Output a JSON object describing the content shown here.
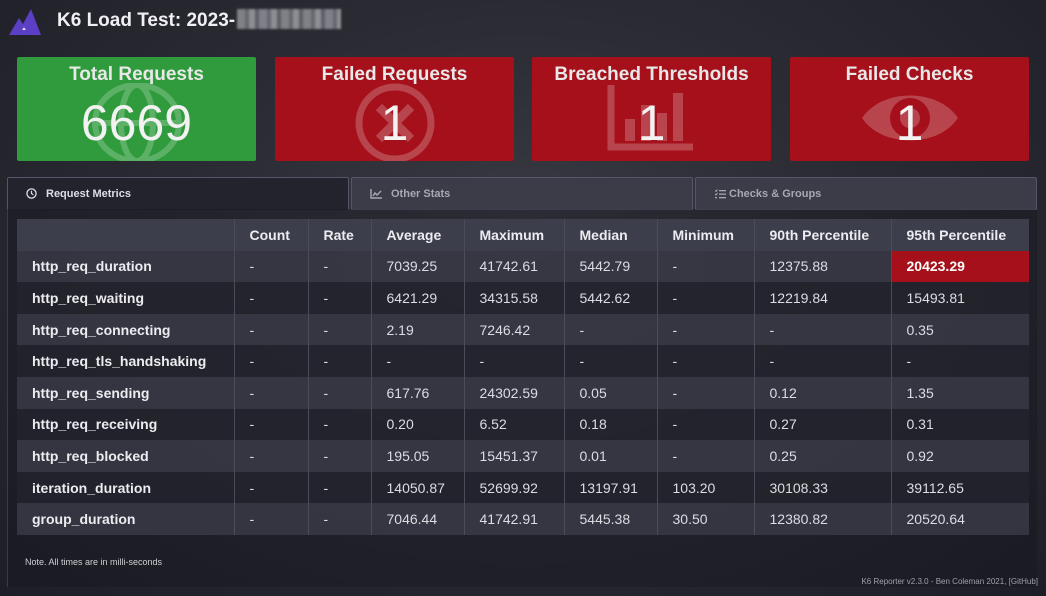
{
  "header": {
    "title": "K6 Load Test: 2023-",
    "logo_icon": "k6-logo-icon"
  },
  "cards": [
    {
      "title": "Total Requests",
      "value": "6669",
      "color": "#2f9b3d",
      "icon": "globe-icon"
    },
    {
      "title": "Failed Requests",
      "value": "1",
      "color": "#a5101b",
      "icon": "x-circle-icon"
    },
    {
      "title": "Breached Thresholds",
      "value": "1",
      "color": "#a5101b",
      "icon": "bar-chart-icon"
    },
    {
      "title": "Failed Checks",
      "value": "1",
      "color": "#a5101b",
      "icon": "eye-icon"
    }
  ],
  "tabs": [
    {
      "label": "Request Metrics",
      "icon": "clock-icon",
      "active": true
    },
    {
      "label": "Other Stats",
      "icon": "line-chart-icon",
      "active": false
    },
    {
      "label": "Checks & Groups",
      "icon": "list-check-icon",
      "active": false
    }
  ],
  "table": {
    "headers": [
      "",
      "Count",
      "Rate",
      "Average",
      "Maximum",
      "Median",
      "Minimum",
      "90th Percentile",
      "95th Percentile"
    ],
    "rows": [
      [
        "http_req_duration",
        "-",
        "-",
        "7039.25",
        "41742.61",
        "5442.79",
        "-",
        "12375.88",
        "20423.29"
      ],
      [
        "http_req_waiting",
        "-",
        "-",
        "6421.29",
        "34315.58",
        "5442.62",
        "-",
        "12219.84",
        "15493.81"
      ],
      [
        "http_req_connecting",
        "-",
        "-",
        "2.19",
        "7246.42",
        "-",
        "-",
        "-",
        "0.35"
      ],
      [
        "http_req_tls_handshaking",
        "-",
        "-",
        "-",
        "-",
        "-",
        "-",
        "-",
        "-"
      ],
      [
        "http_req_sending",
        "-",
        "-",
        "617.76",
        "24302.59",
        "0.05",
        "-",
        "0.12",
        "1.35"
      ],
      [
        "http_req_receiving",
        "-",
        "-",
        "0.20",
        "6.52",
        "0.18",
        "-",
        "0.27",
        "0.31"
      ],
      [
        "http_req_blocked",
        "-",
        "-",
        "195.05",
        "15451.37",
        "0.01",
        "-",
        "0.25",
        "0.92"
      ],
      [
        "iteration_duration",
        "-",
        "-",
        "14050.87",
        "52699.92",
        "13197.91",
        "103.20",
        "30108.33",
        "39112.65"
      ],
      [
        "group_duration",
        "-",
        "-",
        "7046.44",
        "41742.91",
        "5445.38",
        "30.50",
        "12380.82",
        "20520.64"
      ]
    ],
    "breached_cell": {
      "row": 0,
      "col": 8,
      "color": "#a5101b"
    }
  },
  "note": "Note. All times are in milli-seconds",
  "footer": "K6 Reporter v2.3.0 - Ben Coleman 2021, [GitHub]"
}
